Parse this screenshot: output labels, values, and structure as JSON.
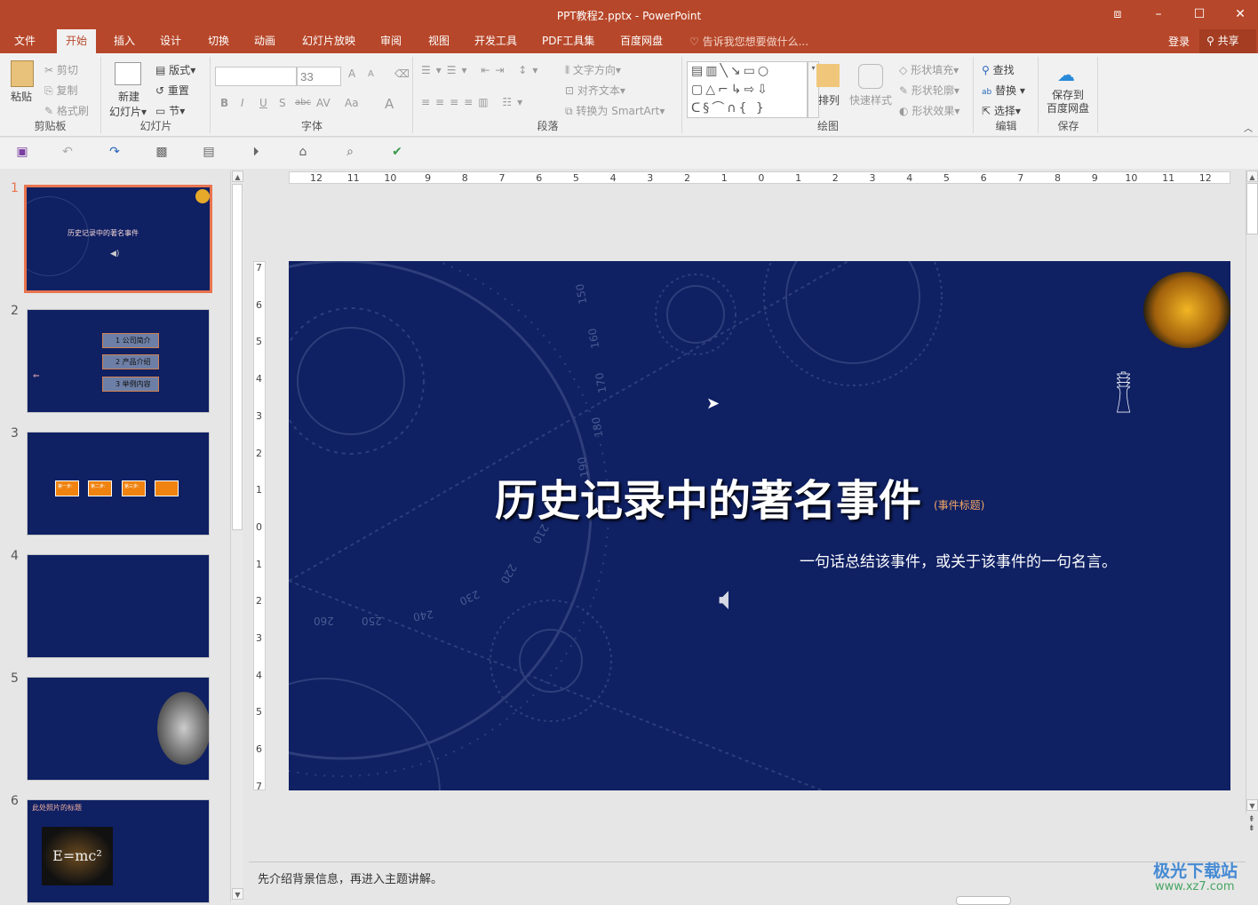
{
  "window": {
    "title": "PPT教程2.pptx - PowerPoint",
    "controls": [
      "ribbon-display-icon",
      "minimize-icon",
      "maximize-icon",
      "close-icon"
    ]
  },
  "tabs": [
    {
      "label": "文件"
    },
    {
      "label": "开始",
      "active": true
    },
    {
      "label": "插入"
    },
    {
      "label": "设计"
    },
    {
      "label": "切换"
    },
    {
      "label": "动画"
    },
    {
      "label": "幻灯片放映"
    },
    {
      "label": "审阅"
    },
    {
      "label": "视图"
    },
    {
      "label": "开发工具"
    },
    {
      "label": "PDF工具集"
    },
    {
      "label": "百度网盘"
    }
  ],
  "tell_me": "告诉我您想要做什么...",
  "account": {
    "login": "登录",
    "share": "共享"
  },
  "ribbon": {
    "clipboard": {
      "label": "剪贴板",
      "paste": "粘贴",
      "cut": "剪切",
      "copy": "复制",
      "format_painter": "格式刷"
    },
    "slides": {
      "label": "幻灯片",
      "new_slide_1": "新建",
      "new_slide_2": "幻灯片",
      "layout": "版式",
      "reset": "重置",
      "section": "节"
    },
    "font": {
      "label": "字体",
      "font_name": "",
      "font_size": "33",
      "bold": "B",
      "italic": "I",
      "underline": "U",
      "shadow": "S",
      "strike": "abc",
      "spacing": "AV",
      "case": "Aa",
      "color": "A",
      "grow": "A",
      "shrink": "A"
    },
    "paragraph": {
      "label": "段落",
      "text_direction": "文字方向",
      "align_text": "对齐文本",
      "smartart": "转换为 SmartArt"
    },
    "drawing": {
      "label": "绘图",
      "arrange": "排列",
      "quick_styles": "快速样式",
      "shape_fill": "形状填充",
      "shape_outline": "形状轮廓",
      "shape_effects": "形状效果"
    },
    "editing": {
      "label": "编辑",
      "find": "查找",
      "replace": "替换",
      "select": "选择"
    },
    "save": {
      "label": "保存",
      "save_baidu_1": "保存到",
      "save_baidu_2": "百度网盘"
    }
  },
  "slides": [
    {
      "number": "1",
      "title": "历史记录中的著名事件",
      "selected": true
    },
    {
      "number": "2",
      "items": [
        "1 公司简介",
        "2 产品介绍",
        "3 举例内容"
      ]
    },
    {
      "number": "3",
      "steps": [
        "第一步:",
        "第二步:",
        "第三步:",
        ""
      ]
    },
    {
      "number": "4"
    },
    {
      "number": "5"
    },
    {
      "number": "6",
      "title": "此处照片的标题",
      "formula": "E=mc²"
    }
  ],
  "ruler": {
    "h": [
      "12",
      "11",
      "10",
      "9",
      "8",
      "7",
      "6",
      "5",
      "4",
      "3",
      "2",
      "1",
      "0",
      "1",
      "2",
      "3",
      "4",
      "5",
      "6",
      "7",
      "8",
      "9",
      "10",
      "11",
      "12"
    ],
    "v": [
      "7",
      "6",
      "5",
      "4",
      "3",
      "2",
      "1",
      "0",
      "1",
      "2",
      "3",
      "4",
      "5",
      "6",
      "7"
    ]
  },
  "current_slide": {
    "title": "历史记录中的著名事件",
    "title_tag": "(事件标题)",
    "subtitle": "一句话总结该事件，或关于该事件的一句名言。",
    "dial_numbers": [
      "150",
      "160",
      "170",
      "180",
      "190",
      "210",
      "220",
      "230",
      "240",
      "250",
      "260"
    ]
  },
  "notes": "先介绍背景信息，再进入主题讲解。",
  "watermark": {
    "name": "极光下载站",
    "url": "www.xz7.com"
  },
  "colors": {
    "accent": "#b7472a",
    "slide_bg": "#0f2063",
    "selection": "#e8744f",
    "orange": "#f0820f"
  }
}
